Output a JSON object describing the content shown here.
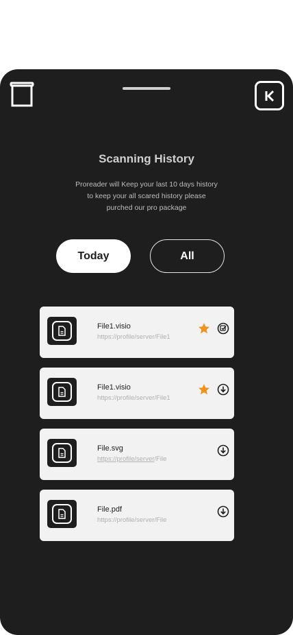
{
  "header": {
    "title": "Scanning History",
    "description_lines": [
      "Proreader will Keep your last 10 days history",
      "to keep your all scared history please",
      "purched our pro package"
    ]
  },
  "tabs": [
    {
      "label": "Today",
      "selected": true
    },
    {
      "label": "All",
      "selected": false
    }
  ],
  "files": [
    {
      "name": "File1.visio",
      "path": "https://profile/server/File1",
      "starred": true,
      "action_icon": "check-circle-icon"
    },
    {
      "name": "File1.visio",
      "path": "https://profile/server/File1",
      "starred": true,
      "action_icon": "download-icon"
    },
    {
      "name": "File.svg",
      "path_underlined": "https://profile/server",
      "path_rest": "/File",
      "starred": false,
      "action_icon": "download-icon"
    },
    {
      "name": "File.pdf",
      "path": "https://profile/server/File",
      "starred": false,
      "action_icon": "download-icon"
    }
  ],
  "colors": {
    "background": "#1e1e1e",
    "card": "#f2f2f2",
    "star": "#f0921e"
  }
}
